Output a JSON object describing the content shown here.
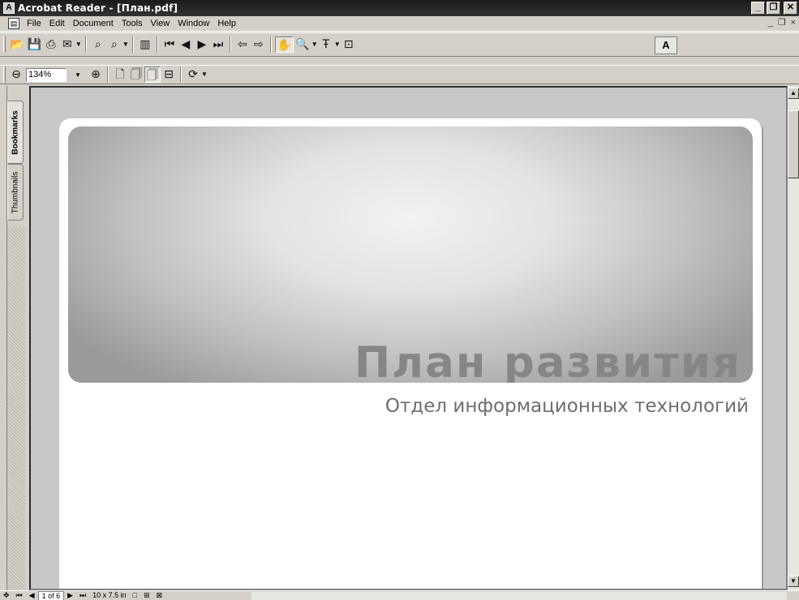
{
  "window": {
    "title": "Acrobat Reader - [План.pdf]",
    "buttons": {
      "minimize": "_",
      "restore": "❐",
      "close": "✕"
    }
  },
  "menu": {
    "items": [
      "File",
      "Edit",
      "Document",
      "Tools",
      "View",
      "Window",
      "Help"
    ],
    "doc_controls": {
      "minimize": "_",
      "restore": "❐",
      "close": "×"
    }
  },
  "toolbar": {
    "zoom_value": "134%"
  },
  "side_tabs": {
    "bookmarks": "Bookmarks",
    "thumbnails": "Thumbnails"
  },
  "document": {
    "title": "План развития",
    "subtitle": "Отдел информационных технологий"
  },
  "status": {
    "page_indicator": "1 of 6",
    "page_size": "10 x 7.5 in"
  }
}
